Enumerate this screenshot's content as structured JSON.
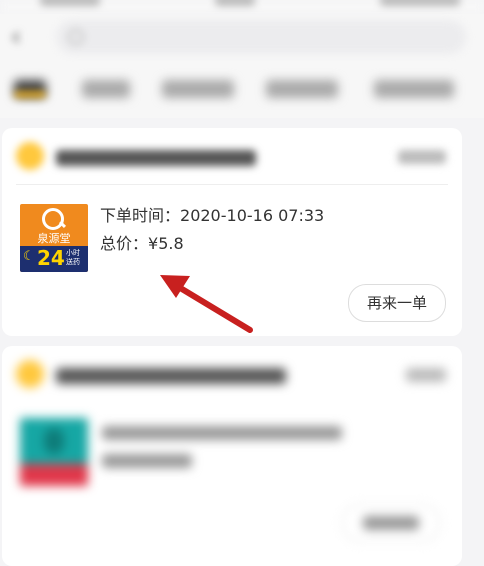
{
  "orders": [
    {
      "thumbnail": {
        "brand": "泉源堂",
        "hours": "24",
        "service": "小时送药",
        "colors": {
          "bg": "#f08a1e",
          "band": "#1d2f6f",
          "accent": "#ffd400"
        }
      },
      "order_time_label": "下单时间：",
      "order_time": "2020-10-16 07:33",
      "total_label": "总价：",
      "total_value": "¥5.8",
      "reorder_label": "再来一单"
    }
  ],
  "colors": {
    "page_bg": "#f4f4f6",
    "tab_accent": "#ffb400",
    "arrow": "#c8201f"
  }
}
